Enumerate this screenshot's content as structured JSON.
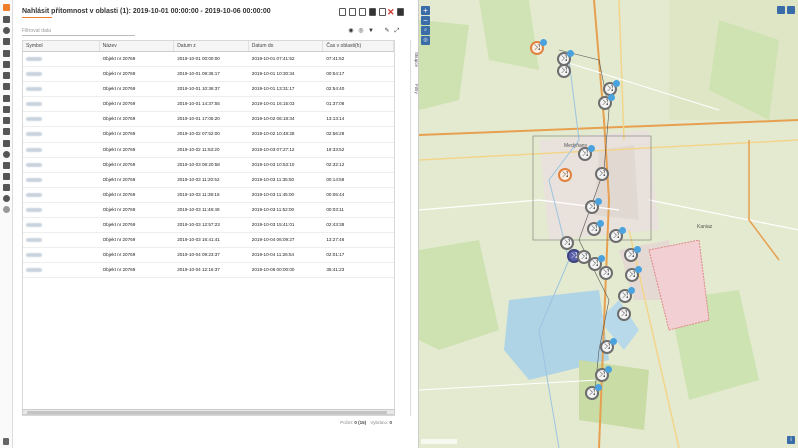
{
  "report": {
    "title": "Nahlásit přítomnost v oblasti (1): 2019-10-01 00:00:00 - 2019-10-06 00:00:00",
    "filter_placeholder": "Filtrovat data",
    "columns": [
      "Symbol",
      "Název",
      "Datum z",
      "Datum do",
      "Čas v oblasti(h)"
    ],
    "rows": [
      {
        "name": "Objekt nr 20769",
        "from": "2019-10-01 00:00:00",
        "to": "2019-10-01 07:41:52",
        "duration": "07:41:52"
      },
      {
        "name": "Objekt nr 20769",
        "from": "2019-10-01 09:36:17",
        "to": "2019-10-01 10:30:34",
        "duration": "00:54:17"
      },
      {
        "name": "Objekt nr 20769",
        "from": "2019-10-01 10:36:37",
        "to": "2019-10-01 13:31:17",
        "duration": "02:54:40"
      },
      {
        "name": "Objekt nr 20769",
        "from": "2019-10-01 14:37:55",
        "to": "2019-10-01 16:15:03",
        "duration": "01:37:08"
      },
      {
        "name": "Objekt nr 20769",
        "from": "2019-10-01 17:05:20",
        "to": "2019-10-02 06:18:34",
        "duration": "13:13:14"
      },
      {
        "name": "Objekt nr 20769",
        "from": "2019-10-02 07:52:00",
        "to": "2019-10-02 10:48:28",
        "duration": "02:56:28"
      },
      {
        "name": "Objekt nr 20769",
        "from": "2019-10-02 11:53:20",
        "to": "2019-10-03 07:27:12",
        "duration": "19:33:52"
      },
      {
        "name": "Objekt nr 20769",
        "from": "2019-10-03 08:20:58",
        "to": "2019-10-03 10:53:10",
        "duration": "02:32:12"
      },
      {
        "name": "Objekt nr 20769",
        "from": "2019-10-03 11:20:52",
        "to": "2019-10-03 11:35:50",
        "duration": "00:14:58"
      },
      {
        "name": "Objekt nr 20769",
        "from": "2019-10-03 11:38:16",
        "to": "2019-10-03 11:45:00",
        "duration": "00:06:44"
      },
      {
        "name": "Objekt nr 20769",
        "from": "2019-10-03 11:48:49",
        "to": "2019-10-03 11:52:00",
        "duration": "00:03:11"
      },
      {
        "name": "Objekt nr 20769",
        "from": "2019-10-03 12:57:23",
        "to": "2019-10-03 15:41:01",
        "duration": "02:43:38"
      },
      {
        "name": "Objekt nr 20769",
        "from": "2019-10-03 16:41:41",
        "to": "2019-10-04 06:09:27",
        "duration": "13:27:46"
      },
      {
        "name": "Objekt nr 20769",
        "from": "2019-10-04 09:23:37",
        "to": "2019-10-04 11:26:54",
        "duration": "02:01:17"
      },
      {
        "name": "Objekt nr 20769",
        "from": "2019-10-04 12:16:37",
        "to": "2019-10-06 00:00:00",
        "duration": "35:41:23"
      }
    ],
    "side_tabs": [
      "Skupce",
      "Filtry"
    ],
    "footer": {
      "label_pocet": "Počet:",
      "pocet": "0 (15)",
      "label_vybrano": "Vybráno:",
      "vybrano": "0"
    }
  },
  "map": {
    "labels": [
      "Medyňany",
      "Kaniaz"
    ]
  }
}
